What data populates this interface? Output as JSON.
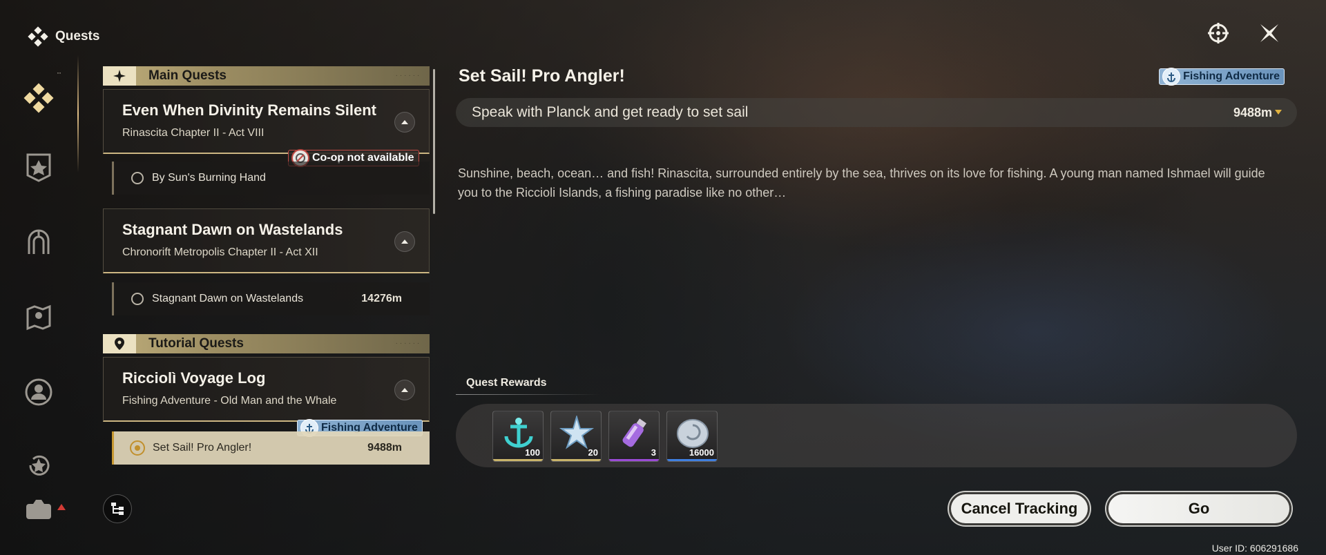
{
  "app": {
    "title": "Quests"
  },
  "sections": {
    "main": {
      "label": "Main Quests"
    },
    "tutorial": {
      "label": "Tutorial Quests"
    }
  },
  "quests": [
    {
      "title": "Even When Divinity Remains Silent",
      "subtitle": "Rinascita Chapter II - Act VIII",
      "step": "By Sun's Burning Hand",
      "badge": "Co-op not available"
    },
    {
      "title": "Stagnant Dawn on Wastelands",
      "subtitle": "Chronorift Metropolis Chapter II - Act XII",
      "step": "Stagnant Dawn on Wastelands",
      "distance": "14276m"
    },
    {
      "title": "Ricciolì Voyage Log",
      "subtitle": "Fishing Adventure - Old Man and the Whale",
      "step": "Set Sail! Pro Angler!",
      "distance": "9488m",
      "badge": "Fishing Adventure"
    }
  ],
  "detail": {
    "title": "Set Sail! Pro Angler!",
    "badge": "Fishing Adventure",
    "objective": "Speak with Planck and get ready to set sail",
    "distance": "9488m",
    "description": "Sunshine, beach, ocean… and fish! Rinascita, surrounded entirely by the sea, thrives on its love for fishing. A young man named Ishmael will guide you to the Riccioli Islands, a fishing paradise like no other…",
    "rewards_label": "Quest Rewards",
    "rewards": [
      {
        "icon": "anchor-crystal-icon",
        "count": "100",
        "rarity_color": "#c9b46a"
      },
      {
        "icon": "star-shard-icon",
        "count": "20",
        "rarity_color": "#c9b46a"
      },
      {
        "icon": "potion-vial-icon",
        "count": "3",
        "rarity_color": "#9b4bd6"
      },
      {
        "icon": "shell-coin-icon",
        "count": "16000",
        "rarity_color": "#3f7fe0"
      }
    ]
  },
  "buttons": {
    "cancel": "Cancel Tracking",
    "go": "Go"
  },
  "user_id": "User ID: 606291686",
  "colors": {
    "accent_gold": "#cdb783",
    "fishing_blue": "#8fb3d4",
    "coop_red": "#c04a45"
  }
}
